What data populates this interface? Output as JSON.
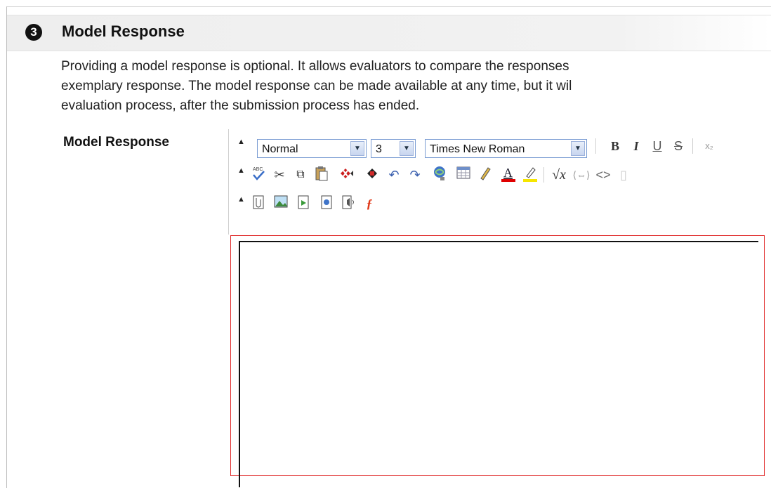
{
  "section": {
    "number": "3",
    "title": "Model Response",
    "description": [
      "Providing a model response is optional. It allows evaluators to compare the responses",
      "exemplary response. The model response can be made available at any time, but it wil",
      "evaluation process, after the submission process has ended."
    ]
  },
  "field": {
    "label": "Model Response",
    "editor_value": ""
  },
  "toolbar": {
    "format_select": "Normal",
    "size_select": "3",
    "font_select": "Times New Roman",
    "bold": "B",
    "italic": "I",
    "underline": "U",
    "strike": "S",
    "subscript": "x₂",
    "collapse_arrow": "▲"
  },
  "colors": {
    "editor_border": "#e02828",
    "font_color_bar": "#e00000",
    "highlight_bar": "#f6e600",
    "select_border": "#7a9cd3"
  },
  "icons": [
    "spellcheck-icon",
    "cut-icon",
    "copy-icon",
    "paste-icon",
    "delete-icon",
    "undo-icon",
    "redo-icon",
    "link-icon",
    "table-icon",
    "pencil-icon",
    "font-color-icon",
    "highlight-icon",
    "math-icon",
    "embed-icon",
    "html-icon",
    "attach-file-icon",
    "image-icon",
    "media-icon",
    "document-icon",
    "audio-icon",
    "flash-icon"
  ]
}
